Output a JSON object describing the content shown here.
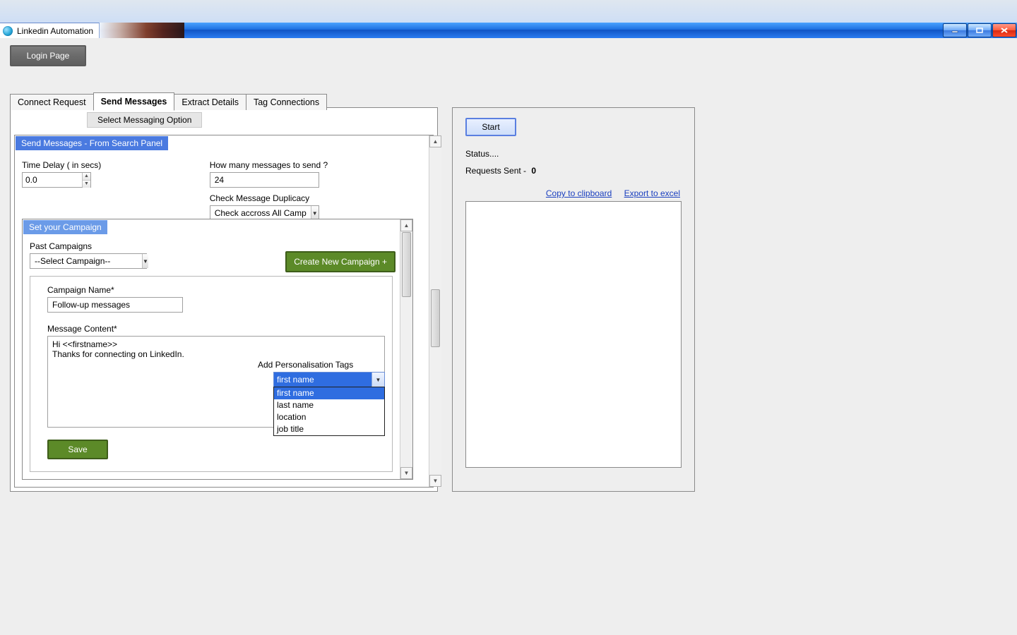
{
  "window": {
    "title": "Linkedin Automation"
  },
  "buttons": {
    "login": "Login Page",
    "start": "Start",
    "create_campaign": "Create New Campaign +",
    "save": "Save",
    "select_msg_option": "Select Messaging Option"
  },
  "tabs": {
    "items": [
      {
        "label": "Connect Request",
        "active": false
      },
      {
        "label": "Send Messages",
        "active": true
      },
      {
        "label": "Extract Details",
        "active": false
      },
      {
        "label": "Tag Connections",
        "active": false
      }
    ]
  },
  "section": {
    "title": "Send Messages - From Search Panel",
    "campaign_title": "Set your Campaign"
  },
  "form": {
    "time_delay_label": "Time Delay ( in secs)",
    "time_delay_value": "0.0",
    "how_many_label": "How many messages to send ?",
    "how_many_value": "24",
    "duplicacy_label": "Check Message Duplicacy",
    "duplicacy_value": "Check accross All Campaigns",
    "past_campaigns_label": "Past Campaigns",
    "past_campaigns_value": "--Select Campaign--",
    "campaign_name_label": "Campaign Name*",
    "campaign_name_value": "Follow-up messages",
    "message_content_label": "Message Content*",
    "message_content_value": "Hi <<firstname>>\nThanks for connecting on LinkedIn.",
    "pers_label": "Add Personalisation Tags",
    "pers_selected": "first name",
    "pers_options": [
      "first name",
      "last name",
      "location",
      "job title"
    ]
  },
  "right": {
    "status_label": "Status....",
    "requests_label": "Requests Sent -",
    "requests_value": "0",
    "copy": "Copy to clipboard",
    "export": "Export to excel"
  }
}
